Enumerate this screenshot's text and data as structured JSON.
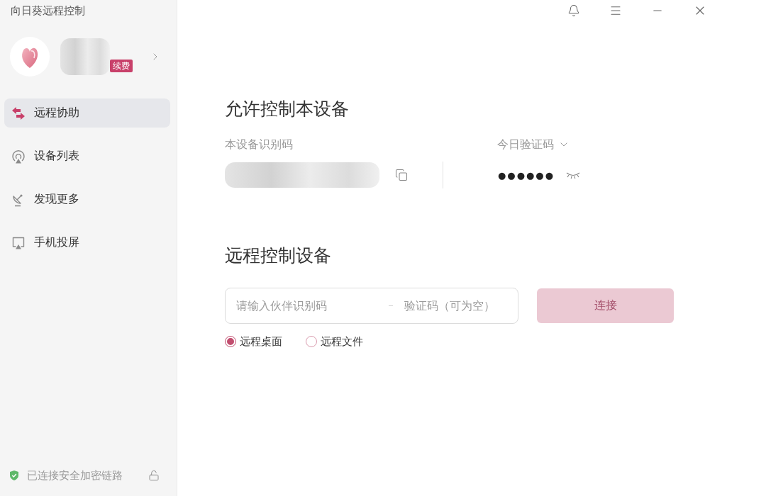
{
  "window": {
    "title": "向日葵远程控制"
  },
  "account": {
    "badge": "续费"
  },
  "nav": [
    {
      "label": "远程协助",
      "selected": true
    },
    {
      "label": "设备列表",
      "selected": false
    },
    {
      "label": "发现更多",
      "selected": false
    },
    {
      "label": "手机投屏",
      "selected": false
    }
  ],
  "status_bar": {
    "text": "已连接安全加密链路"
  },
  "allow_control": {
    "title": "允许控制本设备",
    "device_id_label": "本设备识别码",
    "code_label": "今日验证码",
    "code_value": "●●●●●●"
  },
  "remote_control": {
    "title": "远程控制设备",
    "partner_field": {
      "placeholder": "请输入伙伴识别码"
    },
    "code_field": {
      "placeholder": "验证码（可为空）"
    },
    "connect_button": {
      "label": "连接",
      "disabled": true
    },
    "modes": [
      {
        "label": "远程桌面",
        "selected": true
      },
      {
        "label": "远程文件",
        "selected": false
      }
    ]
  }
}
